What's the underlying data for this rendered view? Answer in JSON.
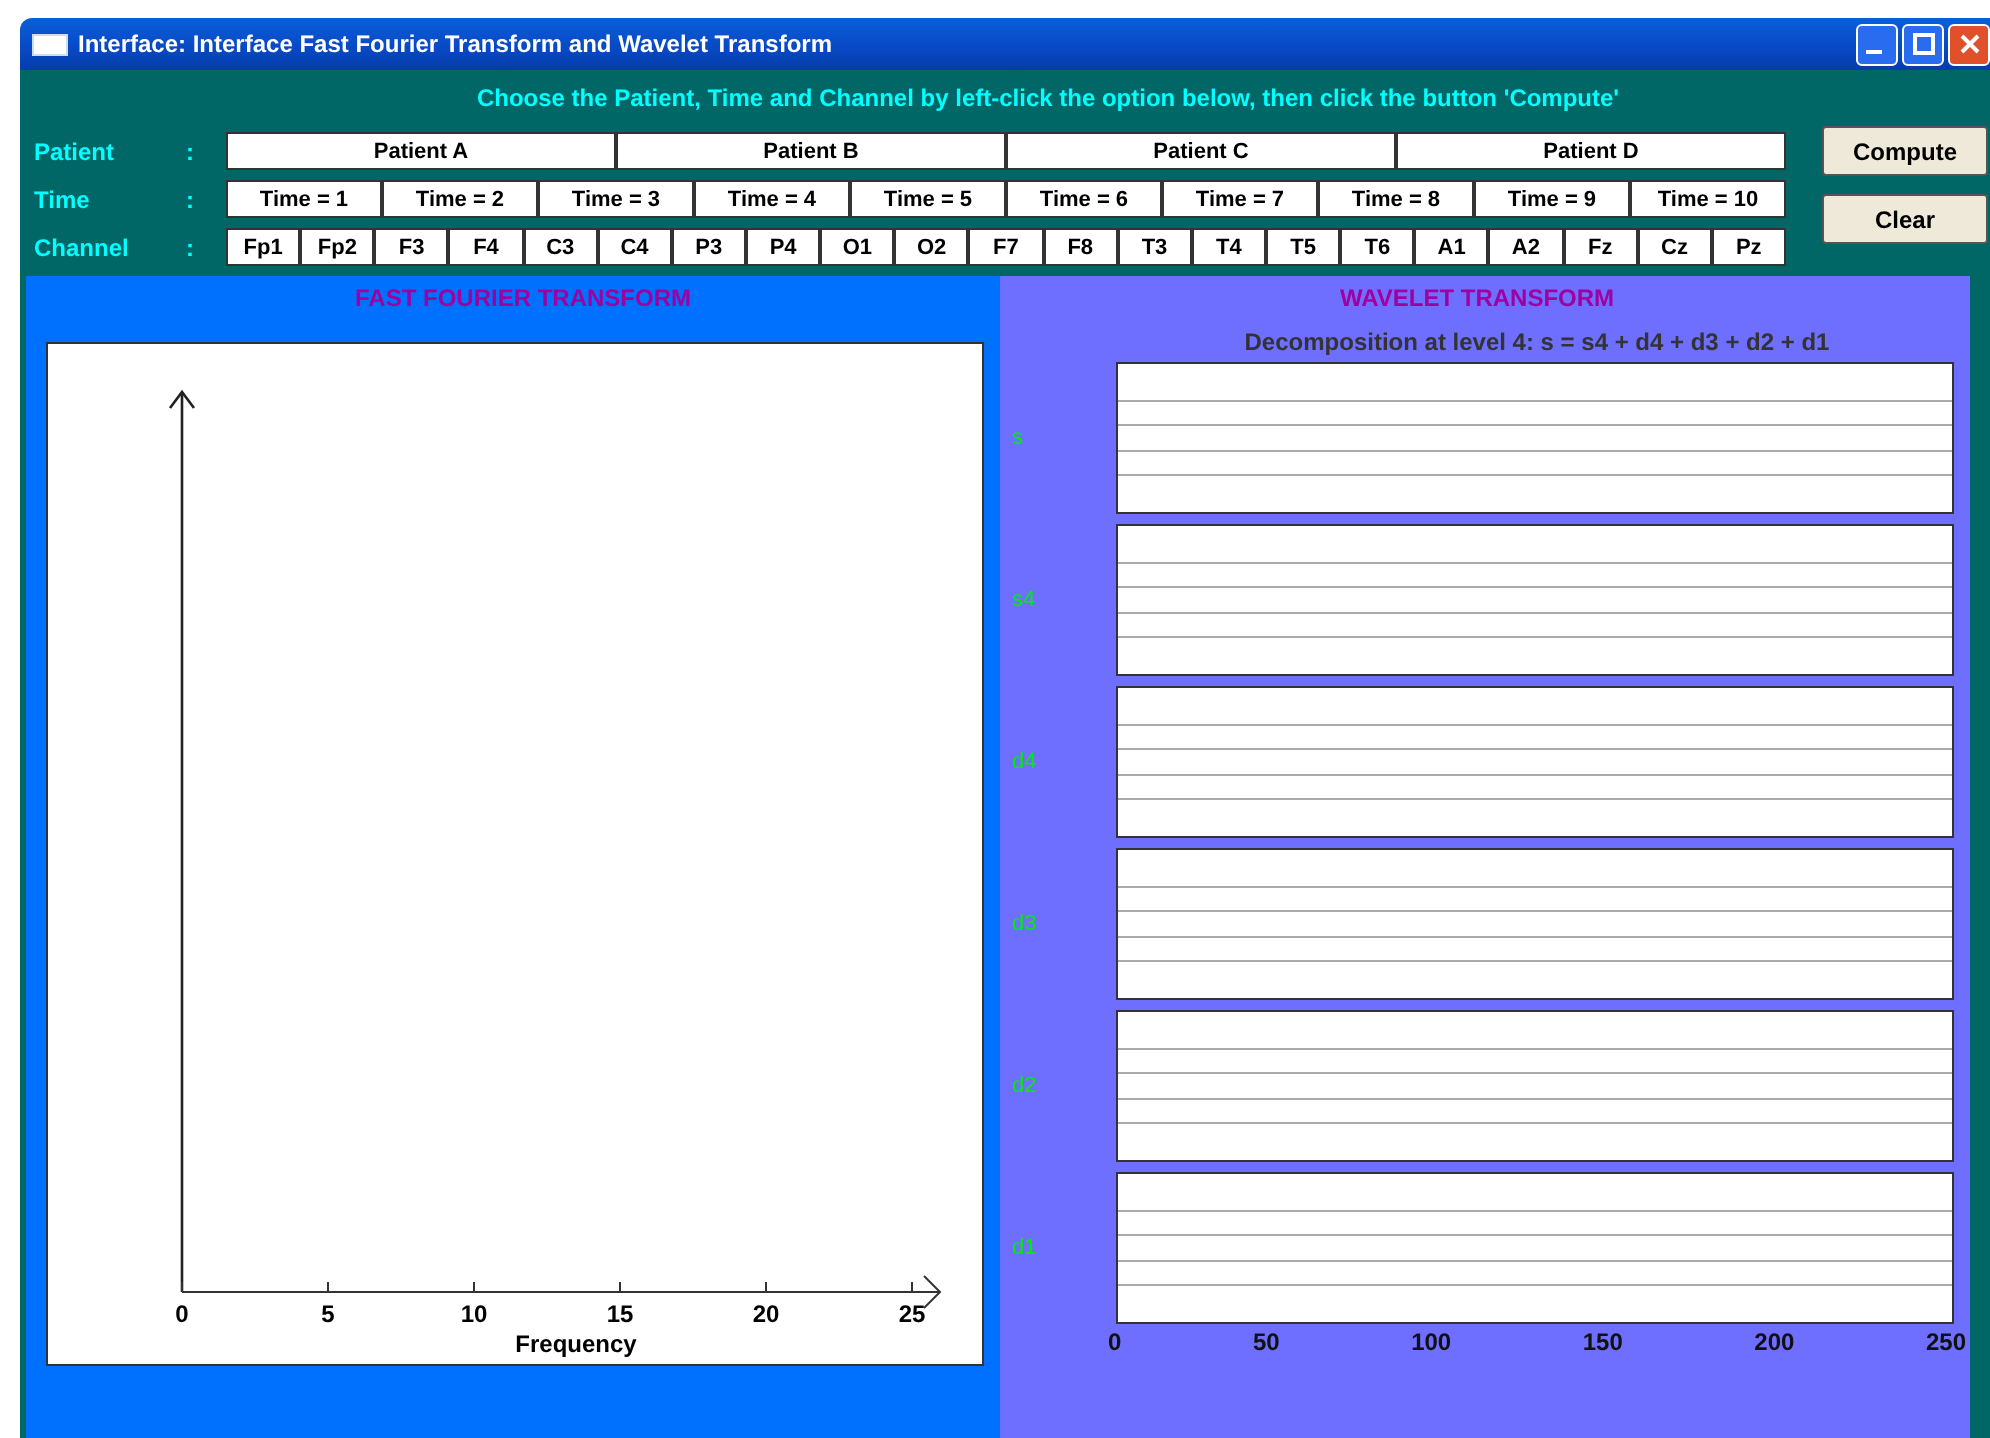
{
  "window": {
    "title": "Interface: Interface Fast Fourier Transform and Wavelet Transform"
  },
  "instruction": "Choose the Patient, Time and Channel by left-click the option below, then click the button 'Compute'",
  "selectors": [
    {
      "label": "Patient",
      "separator": ":",
      "options": [
        "Patient A",
        "Patient B",
        "Patient C",
        "Patient D"
      ]
    },
    {
      "label": "Time",
      "separator": ":",
      "options": [
        "Time = 1",
        "Time = 2",
        "Time = 3",
        "Time = 4",
        "Time = 5",
        "Time = 6",
        "Time = 7",
        "Time = 8",
        "Time = 9",
        "Time = 10"
      ]
    },
    {
      "label": "Channel",
      "separator": ":",
      "options": [
        "Fp1",
        "Fp2",
        "F3",
        "F4",
        "C3",
        "C4",
        "P3",
        "P4",
        "O1",
        "O2",
        "F7",
        "F8",
        "T3",
        "T4",
        "T5",
        "T6",
        "A1",
        "A2",
        "Fz",
        "Cz",
        "Pz"
      ]
    }
  ],
  "buttons": [
    "Compute",
    "Clear"
  ],
  "fft": {
    "title": "FAST FOURIER TRANSFORM",
    "xlabel": "Frequency",
    "xticks": [
      "0",
      "5",
      "10",
      "15",
      "20",
      "25"
    ]
  },
  "wavelet": {
    "title": "WAVELET TRANSFORM",
    "subtitle": "Decomposition at level 4: s = s4 + d4 + d3 + d2 + d1",
    "bands": [
      "s",
      "s4",
      "d4",
      "d3",
      "d2",
      "d1"
    ],
    "xticks": [
      "0",
      "50",
      "100",
      "150",
      "200",
      "250"
    ]
  }
}
